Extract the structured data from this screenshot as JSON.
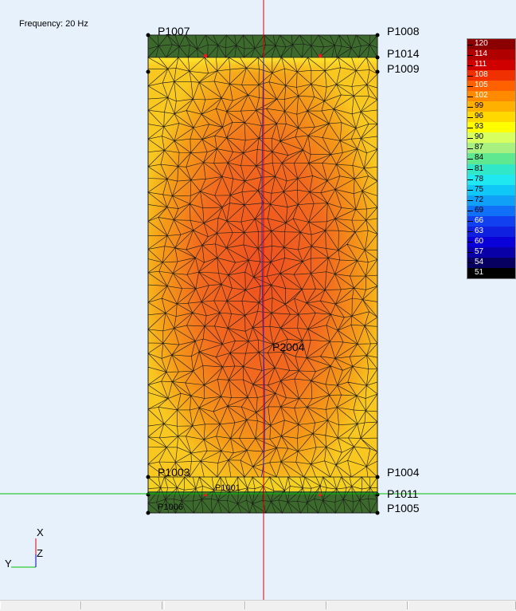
{
  "frequency_label": "Frequency: 20 Hz",
  "points": {
    "p1007": "P1007",
    "p1008": "P1008",
    "p1014": "P1014",
    "p1009": "P1009",
    "p1004": "P1004",
    "p1011": "P1011",
    "p1005": "P1005",
    "p1001": "P1001",
    "p1003": "P1003",
    "p1006": "P1006",
    "p2004": "P2004"
  },
  "axes": {
    "x": "X",
    "y": "Y",
    "z": "Z"
  },
  "colors": {
    "background": "#e6f1fb",
    "mesh_line": "#1a1a1a",
    "solid_end": "#3c6a2c",
    "axis_red": "#e00000",
    "axis_green": "#00c000",
    "axis_blue": "#0000cc"
  },
  "scale": {
    "labels": [
      "120",
      "114",
      "111",
      "108",
      "105",
      "102",
      "99",
      "96",
      "93",
      "90",
      "87",
      "84",
      "81",
      "78",
      "75",
      "72",
      "69",
      "66",
      "63",
      "60",
      "57",
      "54",
      "51"
    ],
    "colors": [
      "#8b0000",
      "#b00000",
      "#d00000",
      "#f03000",
      "#ff6000",
      "#ff8a00",
      "#ffb000",
      "#ffd800",
      "#ffff00",
      "#d8ff60",
      "#a8f080",
      "#60e890",
      "#30e8c8",
      "#20e8f0",
      "#10c8f8",
      "#10a0f8",
      "#1070f8",
      "#1040f0",
      "#1020e0",
      "#0a00d8",
      "#0a00a8",
      "#080060",
      "#000000"
    ]
  }
}
